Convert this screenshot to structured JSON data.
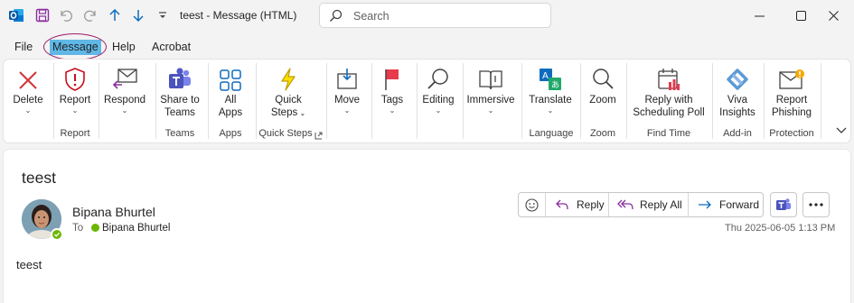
{
  "titlebar": {
    "title": "teest  -  Message (HTML)",
    "search_placeholder": "Search",
    "icons": [
      "outlook-icon",
      "save-icon",
      "undo-icon",
      "redo-icon",
      "up-arrow-icon",
      "down-arrow-icon",
      "customize-icon"
    ]
  },
  "menu": {
    "file": "File",
    "message": "Message",
    "help": "Help",
    "acrobat": "Acrobat"
  },
  "ribbon": {
    "delete": "Delete",
    "report": "Report",
    "respond": "Respond",
    "share_teams_1": "Share to",
    "share_teams_2": "Teams",
    "all_apps_1": "All",
    "all_apps_2": "Apps",
    "quick_steps_1": "Quick",
    "quick_steps_2": "Steps",
    "move": "Move",
    "tags": "Tags",
    "editing": "Editing",
    "immersive": "Immersive",
    "translate": "Translate",
    "zoom": "Zoom",
    "reply_sched_1": "Reply with",
    "reply_sched_2": "Scheduling Poll",
    "viva_1": "Viva",
    "viva_2": "Insights",
    "report_phish_1": "Report",
    "report_phish_2": "Phishing",
    "groups": {
      "report": "Report",
      "teams": "Teams",
      "apps": "Apps",
      "quick_steps": "Quick Steps",
      "language": "Language",
      "zoom": "Zoom",
      "find_time": "Find Time",
      "add_in": "Add-in",
      "protection": "Protection"
    }
  },
  "message": {
    "subject": "teest",
    "sender": "Bipana Bhurtel",
    "to_label": "To",
    "to_name": "Bipana Bhurtel",
    "timestamp": "Thu 2025-06-05 1:13 PM",
    "body": "teest",
    "actions": {
      "reply": "Reply",
      "reply_all": "Reply All",
      "forward": "Forward"
    }
  },
  "colors": {
    "accent": "#0f6cbd",
    "menu_highlight": "#5fb7e6",
    "annotation_circle": "#a01a69",
    "presence_green": "#6bb700",
    "delete_red": "#d13438"
  }
}
